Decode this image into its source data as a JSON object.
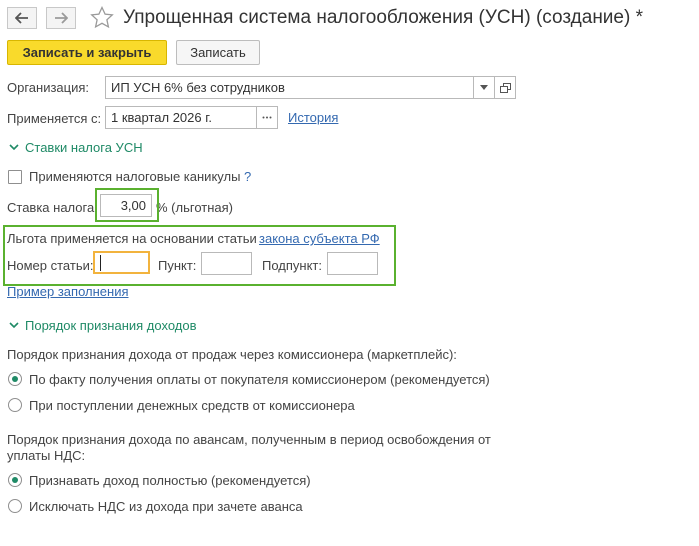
{
  "window": {
    "title": "Упрощенная система налогообложения (УСН) (создание) *"
  },
  "toolbar": {
    "save_close_label": "Записать и закрыть",
    "save_label": "Записать"
  },
  "form": {
    "org_label": "Организация:",
    "org_value": "ИП УСН 6% без сотрудников",
    "applies_label": "Применяется с:",
    "applies_value": "1 квартал 2026 г.",
    "history_link": "История",
    "rates_group": "Ставки налога УСН",
    "holidays_label": "Применяются налоговые каникулы",
    "help_mark": "?",
    "rate_label": "Ставка налога:",
    "rate_value": "3,00",
    "rate_suffix": "% (льготная)",
    "basis_text": "Льгота применяется на основании статьи",
    "basis_link": "закона субъекта РФ",
    "article_label": "Номер статьи:",
    "point_label": "Пункт:",
    "subpoint_label": "Подпункт:",
    "example_link": "Пример заполнения",
    "income_group": "Порядок признания доходов",
    "commission_heading": "Порядок признания дохода от продаж через комиссионера (маркетплейс):",
    "commission_options": [
      "По факту получения оплаты от покупателя комиссионером (рекомендуется)",
      "При поступлении денежных средств от комиссионера"
    ],
    "advance_heading_1": "Порядок признания дохода по авансам, полученным в период освобождения от",
    "advance_heading_2": "уплаты НДС:",
    "advance_options": [
      "Признавать доход полностью (рекомендуется)",
      "Исключать НДС из дохода при зачете аванса"
    ]
  },
  "colors": {
    "accent_green": "#1f8a66",
    "link_blue": "#3469b0",
    "primary_yellow": "#f9da2b",
    "highlight_green": "#5ab12f",
    "focus_orange": "#f2b33d"
  }
}
